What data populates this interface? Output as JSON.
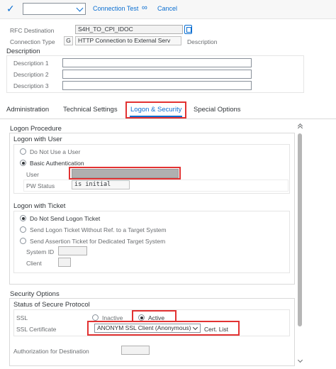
{
  "toolbar": {
    "select_value": "",
    "connection_test": "Connection Test",
    "cancel": "Cancel"
  },
  "header": {
    "rfc_destination_label": "RFC Destination",
    "rfc_destination_value": "S4H_TO_CPI_IDOC",
    "connection_type_label": "Connection Type",
    "connection_type_code": "G",
    "connection_type_value": "HTTP Connection to External Serv",
    "description_suffix": "Description"
  },
  "description": {
    "title": "Description",
    "fields": [
      {
        "label": "Description 1",
        "value": ""
      },
      {
        "label": "Description 2",
        "value": ""
      },
      {
        "label": "Description 3",
        "value": ""
      }
    ]
  },
  "tabs": [
    {
      "label": "Administration"
    },
    {
      "label": "Technical Settings"
    },
    {
      "label": "Logon & Security"
    },
    {
      "label": "Special Options"
    }
  ],
  "logon_procedure": {
    "title": "Logon Procedure",
    "logon_with_user": {
      "title": "Logon with User",
      "options": [
        {
          "label": "Do Not Use a User",
          "selected": false
        },
        {
          "label": "Basic Authentication",
          "selected": true
        }
      ],
      "user_label": "User",
      "user_value": "",
      "pw_status_label": "PW Status",
      "pw_status_value": "is initial"
    },
    "logon_with_ticket": {
      "title": "Logon with Ticket",
      "options": [
        {
          "label": "Do Not Send Logon Ticket",
          "selected": true
        },
        {
          "label": "Send Logon Ticket Without Ref. to a Target System",
          "selected": false
        },
        {
          "label": "Send Assertion Ticket for Dedicated Target System",
          "selected": false
        }
      ],
      "system_id_label": "System ID",
      "system_id_value": "",
      "client_label": "Client",
      "client_value": ""
    }
  },
  "security_options": {
    "title": "Security Options",
    "status_title": "Status of Secure Protocol",
    "ssl_label": "SSL",
    "ssl_inactive": "Inactive",
    "ssl_active": "Active",
    "ssl_certificate_label": "SSL Certificate",
    "ssl_certificate_value": "ANONYM SSL Client (Anonymous)",
    "cert_list_label": "Cert. List",
    "authorization_label": "Authorization for Destination",
    "authorization_value": ""
  },
  "colors": {
    "accent": "#0a6ed1",
    "highlight": "#e23232"
  }
}
